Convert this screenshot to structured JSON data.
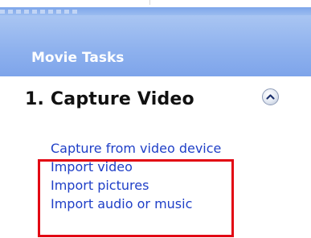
{
  "panel": {
    "title": "Movie Tasks"
  },
  "section": {
    "title": "1. Capture Video",
    "collapse_icon": "chevron-up-icon",
    "links": [
      "Capture from video device",
      "Import video",
      "Import pictures",
      "Import audio or music"
    ]
  },
  "colors": {
    "header_gradient_top": "#a9c5f2",
    "header_gradient_bottom": "#7ea4ea",
    "link": "#1f3fc7",
    "highlight": "#e20613"
  }
}
